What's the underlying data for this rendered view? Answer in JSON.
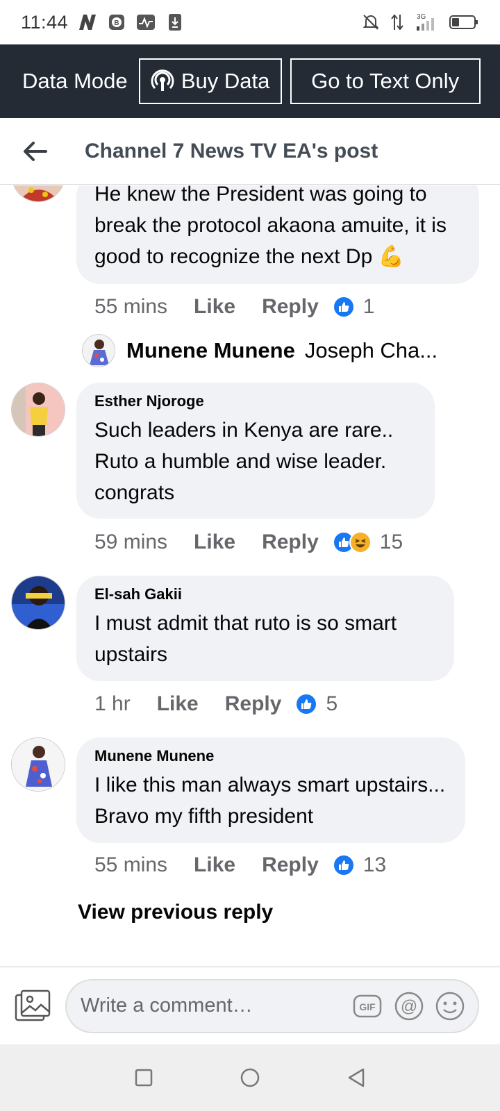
{
  "status_bar": {
    "time": "11:44",
    "network": "3G"
  },
  "data_bar": {
    "mode_label": "Data Mode",
    "buy_label": "Buy Data",
    "text_only_label": "Go to Text Only"
  },
  "header": {
    "title": "Channel 7 News TV EA's post"
  },
  "comments": [
    {
      "author": "",
      "text": "He knew the President was going to break the protocol akaona amuite, it is good to recognize the next Dp 💪",
      "time": "55 mins",
      "like_label": "Like",
      "reply_label": "Reply",
      "reaction_count": "1",
      "reply_preview": {
        "name": "Munene Munene",
        "snippet": "Joseph Cha..."
      }
    },
    {
      "author": "Esther Njoroge",
      "text": "Such leaders in Kenya are rare.. Ruto a humble and wise leader. congrats",
      "time": "59 mins",
      "like_label": "Like",
      "reply_label": "Reply",
      "reaction_count": "15"
    },
    {
      "author": "El-sah Gakii",
      "text": "I must admit that ruto is so smart upstairs",
      "time": "1 hr",
      "like_label": "Like",
      "reply_label": "Reply",
      "reaction_count": "5"
    },
    {
      "author": "Munene Munene",
      "text": "I like this man always smart upstairs... Bravo my fifth president",
      "time": "55 mins",
      "like_label": "Like",
      "reply_label": "Reply",
      "reaction_count": "13"
    }
  ],
  "view_previous_reply": "View previous reply",
  "composer": {
    "placeholder": "Write a comment…",
    "gif_label": "GIF"
  },
  "colors": {
    "data_bar_bg": "#242b35",
    "bubble_bg": "#f0f2f5",
    "like_blue": "#1877f2",
    "haha_yellow": "#f7b125",
    "meta_gray": "#65676b"
  }
}
